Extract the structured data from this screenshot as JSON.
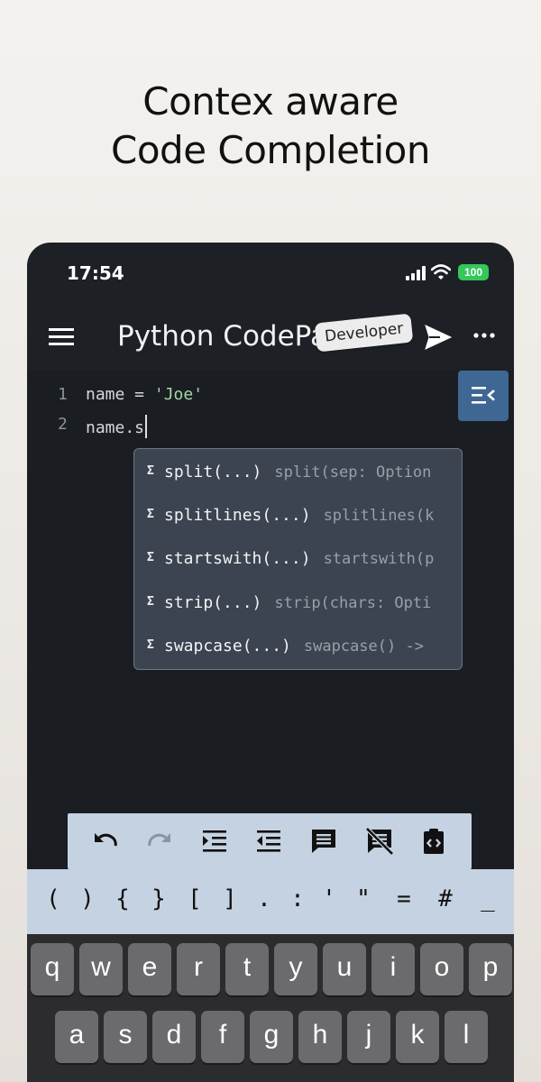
{
  "headline": {
    "line1": "Contex aware",
    "line2": "Code Completion"
  },
  "status": {
    "time": "17:54",
    "battery": "100"
  },
  "appbar": {
    "title": "Python CodePad",
    "badge": "Developer"
  },
  "editor": {
    "lines": [
      {
        "num": "1",
        "pre": "name = ",
        "str": "'Joe'"
      },
      {
        "num": "2",
        "pre": "name.s",
        "str": ""
      }
    ]
  },
  "suggestions": [
    {
      "icon": "Σ",
      "name": "split(...)",
      "sig": "split(sep: Option"
    },
    {
      "icon": "Σ",
      "name": "splitlines(...)",
      "sig": "splitlines(k"
    },
    {
      "icon": "Σ",
      "name": "startswith(...)",
      "sig": "startswith(p"
    },
    {
      "icon": "Σ",
      "name": "strip(...)",
      "sig": "strip(chars: Opti"
    },
    {
      "icon": "Σ",
      "name": "swapcase(...)",
      "sig": "swapcase() ->"
    }
  ],
  "symbols": [
    "(",
    ")",
    "{",
    "}",
    "[",
    "]",
    ".",
    ":",
    "'",
    "\"",
    "=",
    "#",
    "_"
  ],
  "keyboard": {
    "row1": [
      "q",
      "w",
      "e",
      "r",
      "t",
      "y",
      "u",
      "i",
      "o",
      "p"
    ],
    "row2": [
      "a",
      "s",
      "d",
      "f",
      "g",
      "h",
      "j",
      "k",
      "l"
    ]
  },
  "colors": {
    "accent": "#3e6793",
    "toolbar": "#c5d2e1",
    "editor_bg": "#1a1d22",
    "string": "#a5d6a7",
    "battery": "#34c759"
  }
}
